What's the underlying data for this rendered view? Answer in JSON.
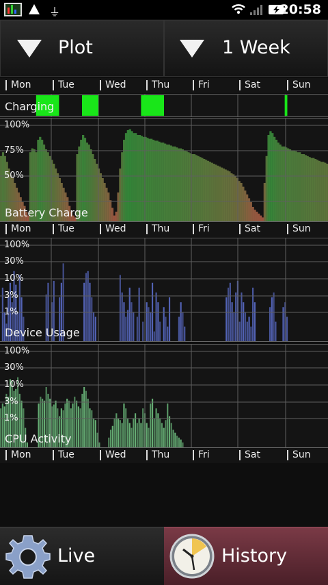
{
  "status_bar": {
    "time": "20:58",
    "icons": [
      "app-icon",
      "warning-icon",
      "usb-icon",
      "wifi-icon",
      "signal-icon",
      "battery-charging-icon"
    ]
  },
  "top_buttons": {
    "plot_label": "Plot",
    "range_label": "1 Week"
  },
  "day_labels": [
    "Mon",
    "Tue",
    "Wed",
    "Thu",
    "Fri",
    "Sat",
    "Sun"
  ],
  "panels": {
    "charging": {
      "label": "Charging",
      "intervals": [
        [
          0.11,
          0.18
        ],
        [
          0.25,
          0.3
        ],
        [
          0.43,
          0.5
        ],
        [
          0.868,
          0.876
        ]
      ]
    },
    "battery": {
      "label": "Battery Charge",
      "ticks": [
        "100%",
        "75%",
        "50%"
      ],
      "values": [
        68,
        72,
        68,
        62,
        55,
        48,
        45,
        40,
        35,
        30,
        25,
        20,
        16,
        10,
        6,
        72,
        76,
        75,
        72,
        85,
        88,
        85,
        80,
        75,
        72,
        68,
        64,
        60,
        55,
        50,
        45,
        40,
        35,
        30,
        25,
        16,
        10,
        6,
        4,
        70,
        78,
        85,
        90,
        87,
        82,
        80,
        75,
        70,
        65,
        60,
        55,
        50,
        45,
        40,
        35,
        30,
        22,
        14,
        6,
        10,
        30,
        55,
        72,
        85,
        92,
        95,
        96,
        94,
        92,
        92,
        90,
        90,
        89,
        88,
        88,
        87,
        86,
        86,
        85,
        84,
        84,
        83,
        82,
        82,
        81,
        80,
        80,
        79,
        78,
        78,
        77,
        76,
        76,
        75,
        74,
        73,
        72,
        71,
        70,
        70,
        69,
        68,
        67,
        66,
        65,
        64,
        63,
        62,
        61,
        60,
        59,
        58,
        57,
        56,
        55,
        54,
        53,
        52,
        50,
        49,
        47,
        45,
        42,
        40,
        36,
        32,
        28,
        24,
        20,
        15,
        12,
        10,
        8,
        6,
        4,
        40,
        68,
        90,
        94,
        92,
        88,
        85,
        82,
        80,
        78,
        78,
        77,
        76,
        75,
        74,
        74,
        73,
        72,
        72,
        70,
        70,
        69,
        68,
        67,
        66,
        66,
        65,
        64,
        63,
        62,
        62,
        61,
        60
      ]
    },
    "usage": {
      "label": "Device Usage",
      "ticks": [
        "100%",
        "30%",
        "10%",
        "3%",
        "1%"
      ],
      "values": [
        0,
        55,
        30,
        18,
        45,
        60,
        40,
        72,
        58,
        30,
        68,
        45,
        25,
        0,
        0,
        0,
        0,
        0,
        0,
        0,
        0,
        0,
        0,
        0,
        48,
        60,
        0,
        40,
        62,
        0,
        0,
        45,
        60,
        80,
        0,
        0,
        0,
        0,
        0,
        0,
        0,
        0,
        0,
        0,
        60,
        70,
        72,
        60,
        45,
        30,
        25,
        0,
        0,
        0,
        0,
        0,
        0,
        0,
        0,
        0,
        0,
        0,
        0,
        68,
        50,
        40,
        25,
        32,
        55,
        40,
        30,
        0,
        25,
        55,
        0,
        20,
        0,
        40,
        35,
        30,
        60,
        10,
        50,
        40,
        20,
        0,
        35,
        25,
        15,
        45,
        0,
        0,
        0,
        0,
        25,
        40,
        30,
        15,
        0,
        0,
        0,
        0,
        0,
        0,
        0,
        0,
        0,
        0,
        0,
        0,
        0,
        0,
        0,
        0,
        0,
        0,
        0,
        0,
        0,
        45,
        55,
        60,
        40,
        30,
        50,
        62,
        20,
        50,
        40,
        30,
        20,
        25,
        15,
        55,
        40,
        0,
        0,
        0,
        0,
        0,
        0,
        0,
        35,
        45,
        50,
        20,
        0,
        0,
        0,
        35,
        40,
        25,
        0,
        0,
        0,
        0,
        0,
        0,
        0,
        0,
        0,
        0,
        0,
        0,
        0,
        0,
        0,
        0,
        0,
        0,
        0,
        0,
        0
      ]
    },
    "cpu": {
      "label": "CPU Activity",
      "ticks": [
        "100%",
        "30%",
        "10%",
        "3%",
        "1%"
      ],
      "values": [
        40,
        45,
        42,
        55,
        52,
        70,
        68,
        58,
        60,
        72,
        55,
        48,
        40,
        20,
        5,
        0,
        0,
        0,
        0,
        0,
        45,
        52,
        50,
        48,
        62,
        55,
        50,
        42,
        44,
        48,
        40,
        32,
        40,
        38,
        45,
        50,
        48,
        40,
        45,
        52,
        48,
        42,
        40,
        55,
        62,
        58,
        50,
        40,
        38,
        30,
        28,
        15,
        5,
        0,
        0,
        0,
        0,
        10,
        18,
        22,
        30,
        35,
        30,
        28,
        25,
        45,
        40,
        30,
        25,
        20,
        30,
        35,
        25,
        30,
        25,
        40,
        35,
        25,
        20,
        45,
        50,
        30,
        40,
        35,
        30,
        25,
        20,
        28,
        45,
        32,
        25,
        18,
        15,
        12,
        10,
        8,
        5,
        0,
        0,
        0,
        0,
        0,
        0,
        0,
        0,
        0,
        0,
        0,
        0,
        0,
        0,
        0,
        0,
        0,
        0,
        0,
        0,
        0,
        0,
        0,
        0,
        0,
        0,
        0,
        0,
        0,
        0,
        0,
        0,
        0,
        0,
        0,
        0,
        0,
        0,
        0,
        0,
        0,
        0,
        0,
        0,
        0,
        0,
        0,
        0,
        0,
        0,
        0,
        0,
        0,
        0,
        0,
        0,
        0,
        0,
        0,
        0,
        0,
        0,
        0,
        0,
        0,
        0,
        0,
        0,
        0,
        0,
        0,
        0,
        0,
        0,
        0,
        0
      ]
    }
  },
  "bottom_buttons": {
    "live_label": "Live",
    "history_label": "History"
  },
  "colors": {
    "charging": "#19e619",
    "usage": "#5a6cc8",
    "cpu": "#6fbf7f",
    "grid": "#5f5f5f"
  }
}
